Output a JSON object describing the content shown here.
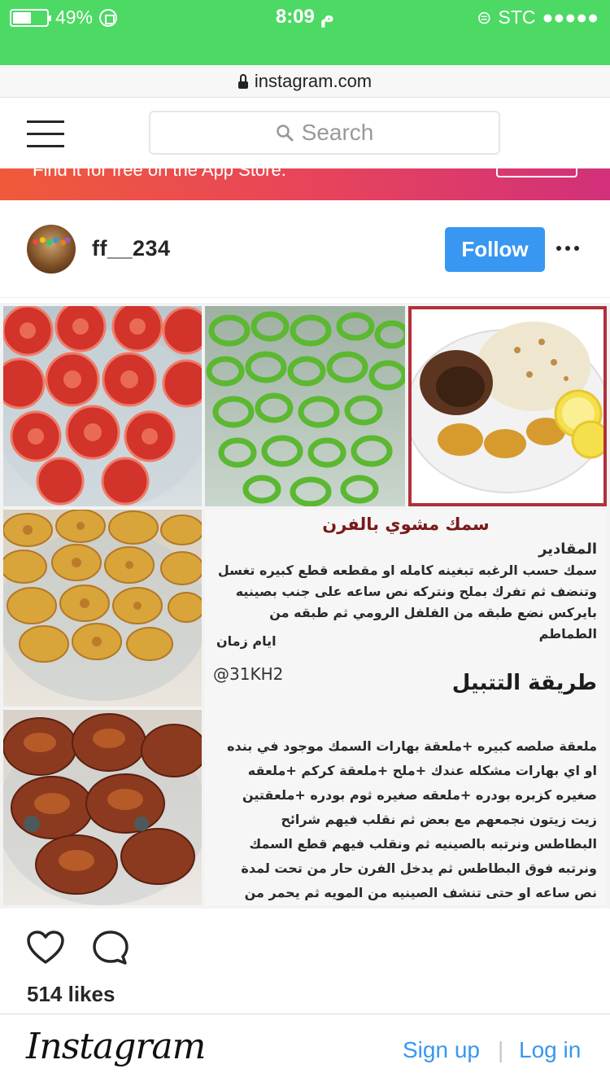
{
  "status_bar": {
    "battery": "49%",
    "battery_level": 0.49,
    "time": "8:09",
    "time_suffix": "م",
    "carrier": "STC",
    "signal": "●●●●●"
  },
  "browser": {
    "url": "instagram.com"
  },
  "header": {
    "search_placeholder": "Search"
  },
  "banner": {
    "text": "Find it for free on the App Store."
  },
  "post": {
    "username": "ff__234",
    "follow_label": "Follow",
    "more_label": "•••",
    "likes": "514 likes",
    "image": {
      "title": "سمك مشوي بالفرن",
      "ingredients_heading": "المقادير",
      "ingredients_text": "سمك حسب الرغبه تبغينه كامله او مقطعه قطع كبيره تغسل وتنضف ثم تفرك بملح ونتركه نص ساعه على جنب بصينيه بايركس نضع طبقه من الفلفل الرومي ثم طبقه من الطماطم",
      "credit": "ايام زمان",
      "handle": "@31KH2",
      "method_heading": "طريقة التتبيل",
      "method_text": "ملعقة صلصه كبيره +ملعقة بهارات السمك موجود في بنده او اي بهارات مشكله عندك +ملح +ملعقة كركم +ملعقه صغيره كزبره بودره +ملعقه صغيره ثوم بودره +ملعقتين زيت زيتون نجمعهم مع بعض ثم نقلب فيهم شرائح البطاطس ونرتبه بالصينيه ثم ونقلب فيهم قطع السمك ونرتبه فوق البطاطس ثم يدخل الفرن حار من تحت لمدة نص ساعه او حتى تنشف الصينيه من المويه ثم يحمر من فوق ويقدم"
    }
  },
  "footer": {
    "logo": "Instagram",
    "signup": "Sign up",
    "separator": "|",
    "login": "Log in"
  },
  "colors": {
    "status_green": "#4cd964",
    "follow_blue": "#3897f0",
    "link_blue": "#3897f0"
  }
}
